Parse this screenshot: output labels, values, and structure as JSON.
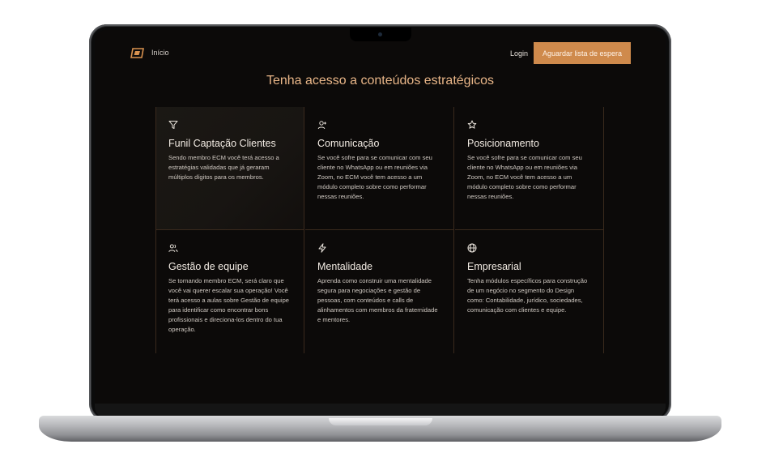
{
  "nav": {
    "home_label": "Início",
    "login_label": "Login",
    "cta_label": "Aguardar lista de espera",
    "logo_icon": "brand-logo-icon"
  },
  "section": {
    "title": "Tenha acesso a conteúdos estratégicos"
  },
  "colors": {
    "accent": "#cf8a4c",
    "title": "#e9b688",
    "background": "#0c0a09"
  },
  "cards": [
    {
      "icon": "filter-icon",
      "title": "Funil Captação Clientes",
      "text": "Sendo membro ECM você terá acesso a estratégias validadas que já geraram múltiplos dígitos para os membros."
    },
    {
      "icon": "user-add-icon",
      "title": "Comunicação",
      "text": "Se você sofre para se comunicar com seu cliente no WhatsApp ou em reuniões via Zoom, no ECM você tem acesso a um módulo completo sobre como performar nessas reuniões."
    },
    {
      "icon": "star-icon",
      "title": "Posicionamento",
      "text": "Se você sofre para se comunicar com seu cliente no WhatsApp ou em reuniões via Zoom, no ECM você tem acesso a um módulo completo sobre como performar nessas reuniões."
    },
    {
      "icon": "users-icon",
      "title": "Gestão de equipe",
      "text": "Se tornando membro ECM, será claro que você vai querer escalar sua operação! Você terá acesso a aulas sobre Gestão de equipe para identificar como encontrar bons profissionais e direciona-los dentro do tua operação."
    },
    {
      "icon": "lightning-icon",
      "title": "Mentalidade",
      "text": "Aprenda como construir uma mentalidade segura para negociações e gestão de pessoas, com conteúdos e calls de alinhamentos com membros da fraternidade e mentores."
    },
    {
      "icon": "globe-icon",
      "title": "Empresarial",
      "text": "Tenha módulos específicos para construção de um negócio no segmento do Design como: Contabilidade, jurídico, sociedades, comunicação com clientes e equipe."
    }
  ]
}
